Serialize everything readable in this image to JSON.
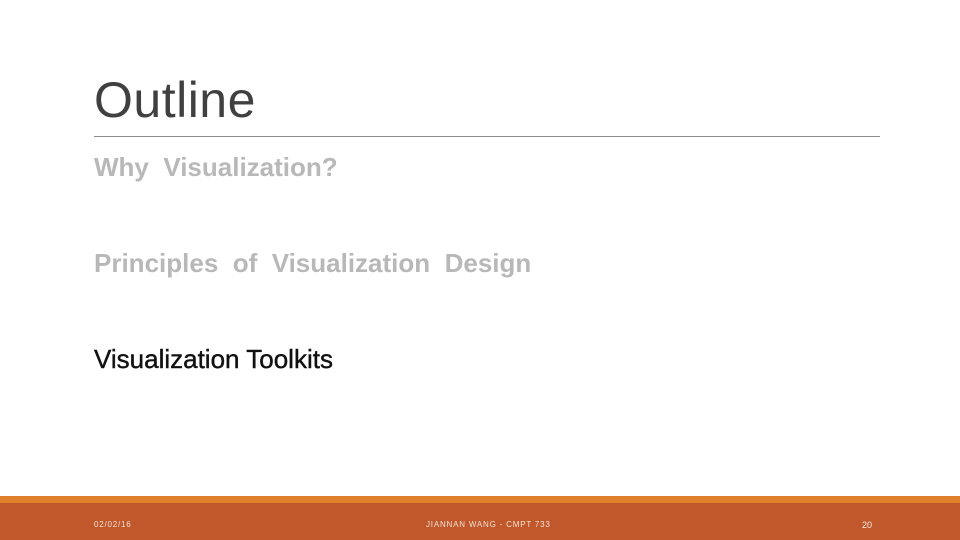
{
  "slide": {
    "title": "Outline",
    "bullets": [
      {
        "text": "Why  Visualization?",
        "state": "dim"
      },
      {
        "text": "Principles  of  Visualization  Design",
        "state": "dim"
      },
      {
        "text": "Visualization Toolkits",
        "state": "active"
      }
    ],
    "footer": {
      "date": "02/02/16",
      "center": "JIANNAN WANG - CMPT 733",
      "page": "20"
    }
  },
  "colors": {
    "footer_bar": "#c0582b",
    "footer_stripe": "#e0802b",
    "dim_text": "#b8b8b8",
    "active_text": "#111111",
    "title_text": "#404040"
  }
}
